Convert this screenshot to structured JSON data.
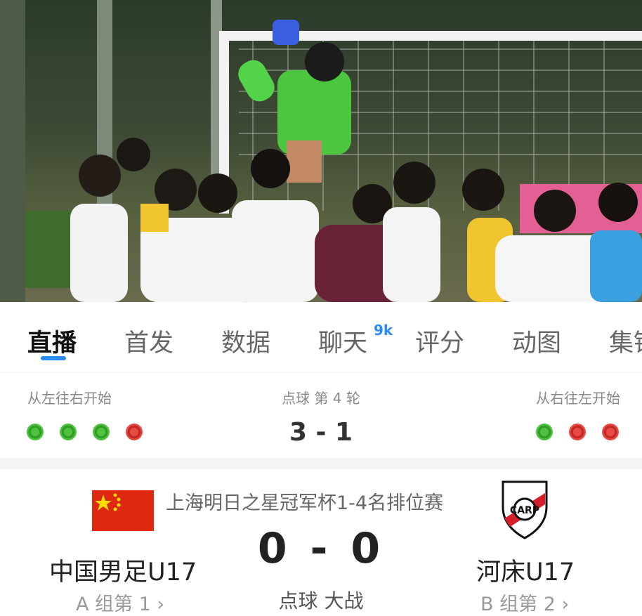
{
  "tabs": [
    {
      "label": "直播"
    },
    {
      "label": "首发"
    },
    {
      "label": "数据"
    },
    {
      "label": "聊天"
    },
    {
      "label": "评分"
    },
    {
      "label": "动图"
    },
    {
      "label": "集锦"
    }
  ],
  "chat_badge": "9k",
  "penalty": {
    "left_hint": "从左往右开始",
    "round": "点球 第 4 轮",
    "right_hint": "从右往左开始",
    "score": "3 - 1",
    "home_kicks": [
      "scored",
      "scored",
      "scored",
      "missed"
    ],
    "away_kicks": [
      "scored",
      "missed",
      "missed"
    ]
  },
  "match": {
    "competition": "上海明日之星冠军杯1-4名排位赛",
    "home": {
      "name": "中国男足U17",
      "group": "A 组第 1 ›",
      "flag": "china-flag"
    },
    "away": {
      "name": "河床U17",
      "group": "B 组第 2 ›",
      "crest": "river-plate-crest"
    },
    "score": "0 - 0",
    "status": "点球 大战"
  },
  "colors": {
    "accent": "#2b8cf5",
    "goal": "#4fc23f",
    "miss": "#e84b44",
    "flag_red": "#de2910",
    "flag_star": "#ffde00"
  }
}
